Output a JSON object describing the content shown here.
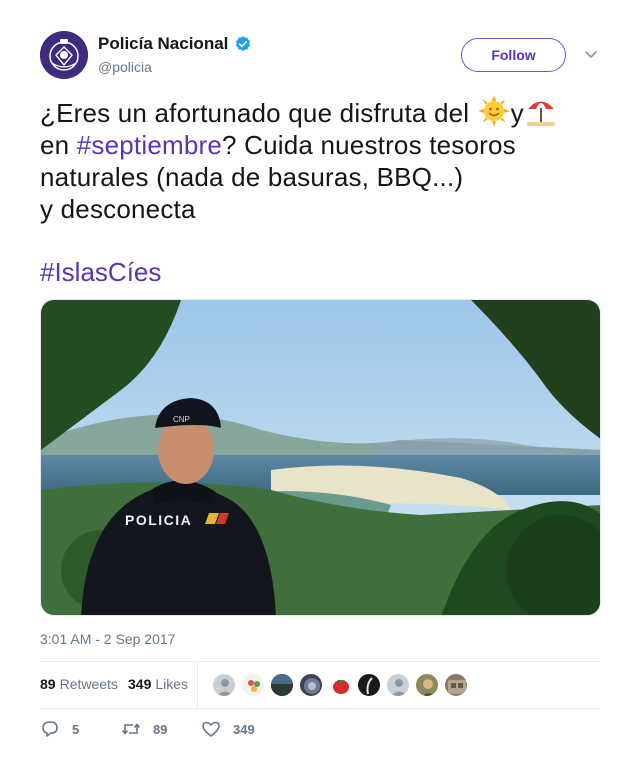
{
  "account": {
    "name": "Policía Nacional",
    "handle": "@policia",
    "verified": true,
    "follow_label": "Follow"
  },
  "tweet": {
    "line1_pre": "¿Eres un afortunado que disfruta del ",
    "line1_mid": "y",
    "line2_pre": "en ",
    "line2_hashtag": "#septiembre",
    "line2_post": "? Cuida nuestros tesoros",
    "line3": "naturales (nada de basuras, BBQ...)",
    "line4": "y desconecta",
    "hashtag_line": "#IslasCíes",
    "emojis": [
      "sun-with-face-icon",
      "beach-umbrella-icon"
    ],
    "image_label": "POLICIA",
    "cap_label": "CNP",
    "timestamp": "3:01 AM - 2 Sep 2017"
  },
  "stats": {
    "retweets_count": "89",
    "retweets_label": "Retweets",
    "likes_count": "349",
    "likes_label": "Likes"
  },
  "actions": {
    "reply_count": "5",
    "retweet_count": "89",
    "like_count": "349"
  },
  "colors": {
    "brand_purple": "#5a34b8",
    "verified_blue": "#1da1f2",
    "muted_text": "#657786"
  }
}
